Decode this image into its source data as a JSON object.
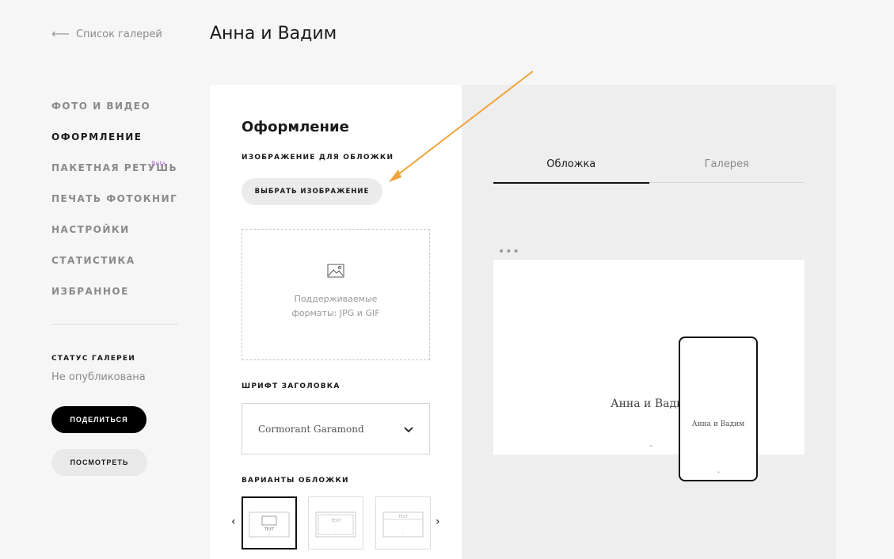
{
  "header": {
    "back_label": "Список галерей",
    "title": "Анна и Вадим"
  },
  "nav": {
    "items": [
      {
        "label": "ФОТО И ВИДЕО"
      },
      {
        "label": "ОФОРМЛЕНИЕ",
        "active": true
      },
      {
        "label": "ПАКЕТНАЯ РЕТУШЬ",
        "badge": "Beta"
      },
      {
        "label": "ПЕЧАТЬ ФОТОКНИГ"
      },
      {
        "label": "НАСТРОЙКИ"
      },
      {
        "label": "СТАТИСТИКА"
      },
      {
        "label": "ИЗБРАННОЕ"
      }
    ]
  },
  "status": {
    "label": "СТАТУС ГАЛЕРЕИ",
    "value": "Не опубликована"
  },
  "actions": {
    "share_label": "ПОДЕЛИТЬСЯ",
    "view_label": "ПОСМОТРЕТЬ"
  },
  "design": {
    "title": "Оформление",
    "cover_image_label": "ИЗОБРАЖЕНИЕ ДЛЯ ОБЛОЖКИ",
    "choose_button": "ВЫБРАТЬ ИЗОБРАЖЕНИЕ",
    "dropzone_hint": "Поддерживаемые форматы: JPG и GIF",
    "font_label": "ШРИФТ ЗАГОЛОВКА",
    "font_value": "Cormorant Garamond",
    "variants_label": "ВАРИАНТЫ ОБЛОЖКИ",
    "variants": [
      {
        "text": "TEXT",
        "selected": true
      },
      {
        "text": "TEXT"
      },
      {
        "text": "TEXT"
      }
    ]
  },
  "preview": {
    "tabs": [
      {
        "label": "Обложка",
        "active": true
      },
      {
        "label": "Галерея"
      }
    ],
    "desktop_title": "Анна и Вадим",
    "mobile_title": "Анна и Вадим"
  },
  "colors": {
    "accent_arrow": "#f0a43a",
    "beta": "#b080d0"
  }
}
